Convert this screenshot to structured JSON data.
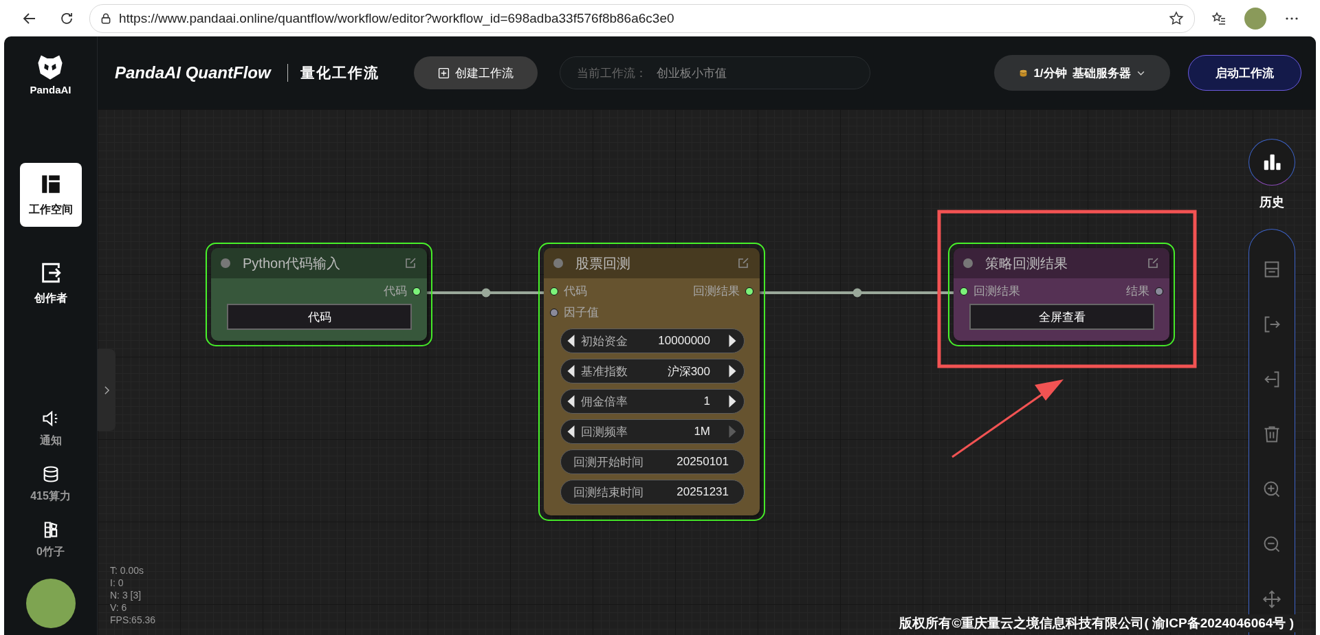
{
  "browser": {
    "url": "https://www.pandaai.online/quantflow/workflow/editor?workflow_id=698adba33f576f8b86a6c3e0"
  },
  "sidebar": {
    "logo_text": "PandaAI",
    "top_items": [
      {
        "label": "工作空间",
        "selected": true
      },
      {
        "label": "创作者",
        "selected": false
      }
    ],
    "bottom_items": [
      {
        "label": "通知"
      },
      {
        "label": "415算力"
      },
      {
        "label": "0竹子"
      }
    ]
  },
  "header": {
    "title": "PandaAI QuantFlow",
    "subtitle": "量化工作流",
    "create_button": "创建工作流",
    "current_workflow": {
      "label": "当前工作流：",
      "value": "创业板小市值"
    },
    "server": {
      "rate": "1/分钟",
      "name": "基础服务器"
    },
    "start_button": "启动工作流"
  },
  "canvas": {
    "nodes": [
      {
        "title": "Python代码输入",
        "color": "#37573b",
        "selected": true,
        "outputs": [
          {
            "label": "代码",
            "connected": true
          }
        ],
        "widgets": [
          {
            "kind": "button",
            "label": "代码"
          }
        ]
      },
      {
        "title": "股票回测",
        "color": "#66532f",
        "selected": true,
        "inputs": [
          {
            "label": "代码",
            "connected": true
          },
          {
            "label": "因子值",
            "connected": false
          }
        ],
        "outputs": [
          {
            "label": "回测结果",
            "connected": true
          }
        ],
        "widgets": [
          {
            "kind": "combo",
            "label": "初始资金",
            "value": "10000000",
            "next_disabled": false
          },
          {
            "kind": "combo",
            "label": "基准指数",
            "value": "沪深300",
            "next_disabled": false
          },
          {
            "kind": "combo",
            "label": "佣金倍率",
            "value": "1",
            "next_disabled": false
          },
          {
            "kind": "combo",
            "label": "回测频率",
            "value": "1M",
            "next_disabled": true
          },
          {
            "kind": "text",
            "label": "回测开始时间",
            "value": "20250101"
          },
          {
            "kind": "text",
            "label": "回测结束时间",
            "value": "20251231"
          }
        ]
      },
      {
        "title": "策略回测结果",
        "color": "#553154",
        "selected": true,
        "inputs": [
          {
            "label": "回测结果",
            "connected": true
          }
        ],
        "outputs": [
          {
            "label": "结果",
            "connected": false
          }
        ],
        "widgets": [
          {
            "kind": "button",
            "label": "全屏查看"
          }
        ]
      }
    ],
    "debug_stats": [
      "T: 0.00s",
      "I: 0",
      "N: 3 [3]",
      "V: 6",
      "FPS:65.36"
    ],
    "history_label": "历史",
    "copyright": "版权所有©重庆量云之境信息科技有限公司( 渝ICP备2024046064号 )"
  }
}
